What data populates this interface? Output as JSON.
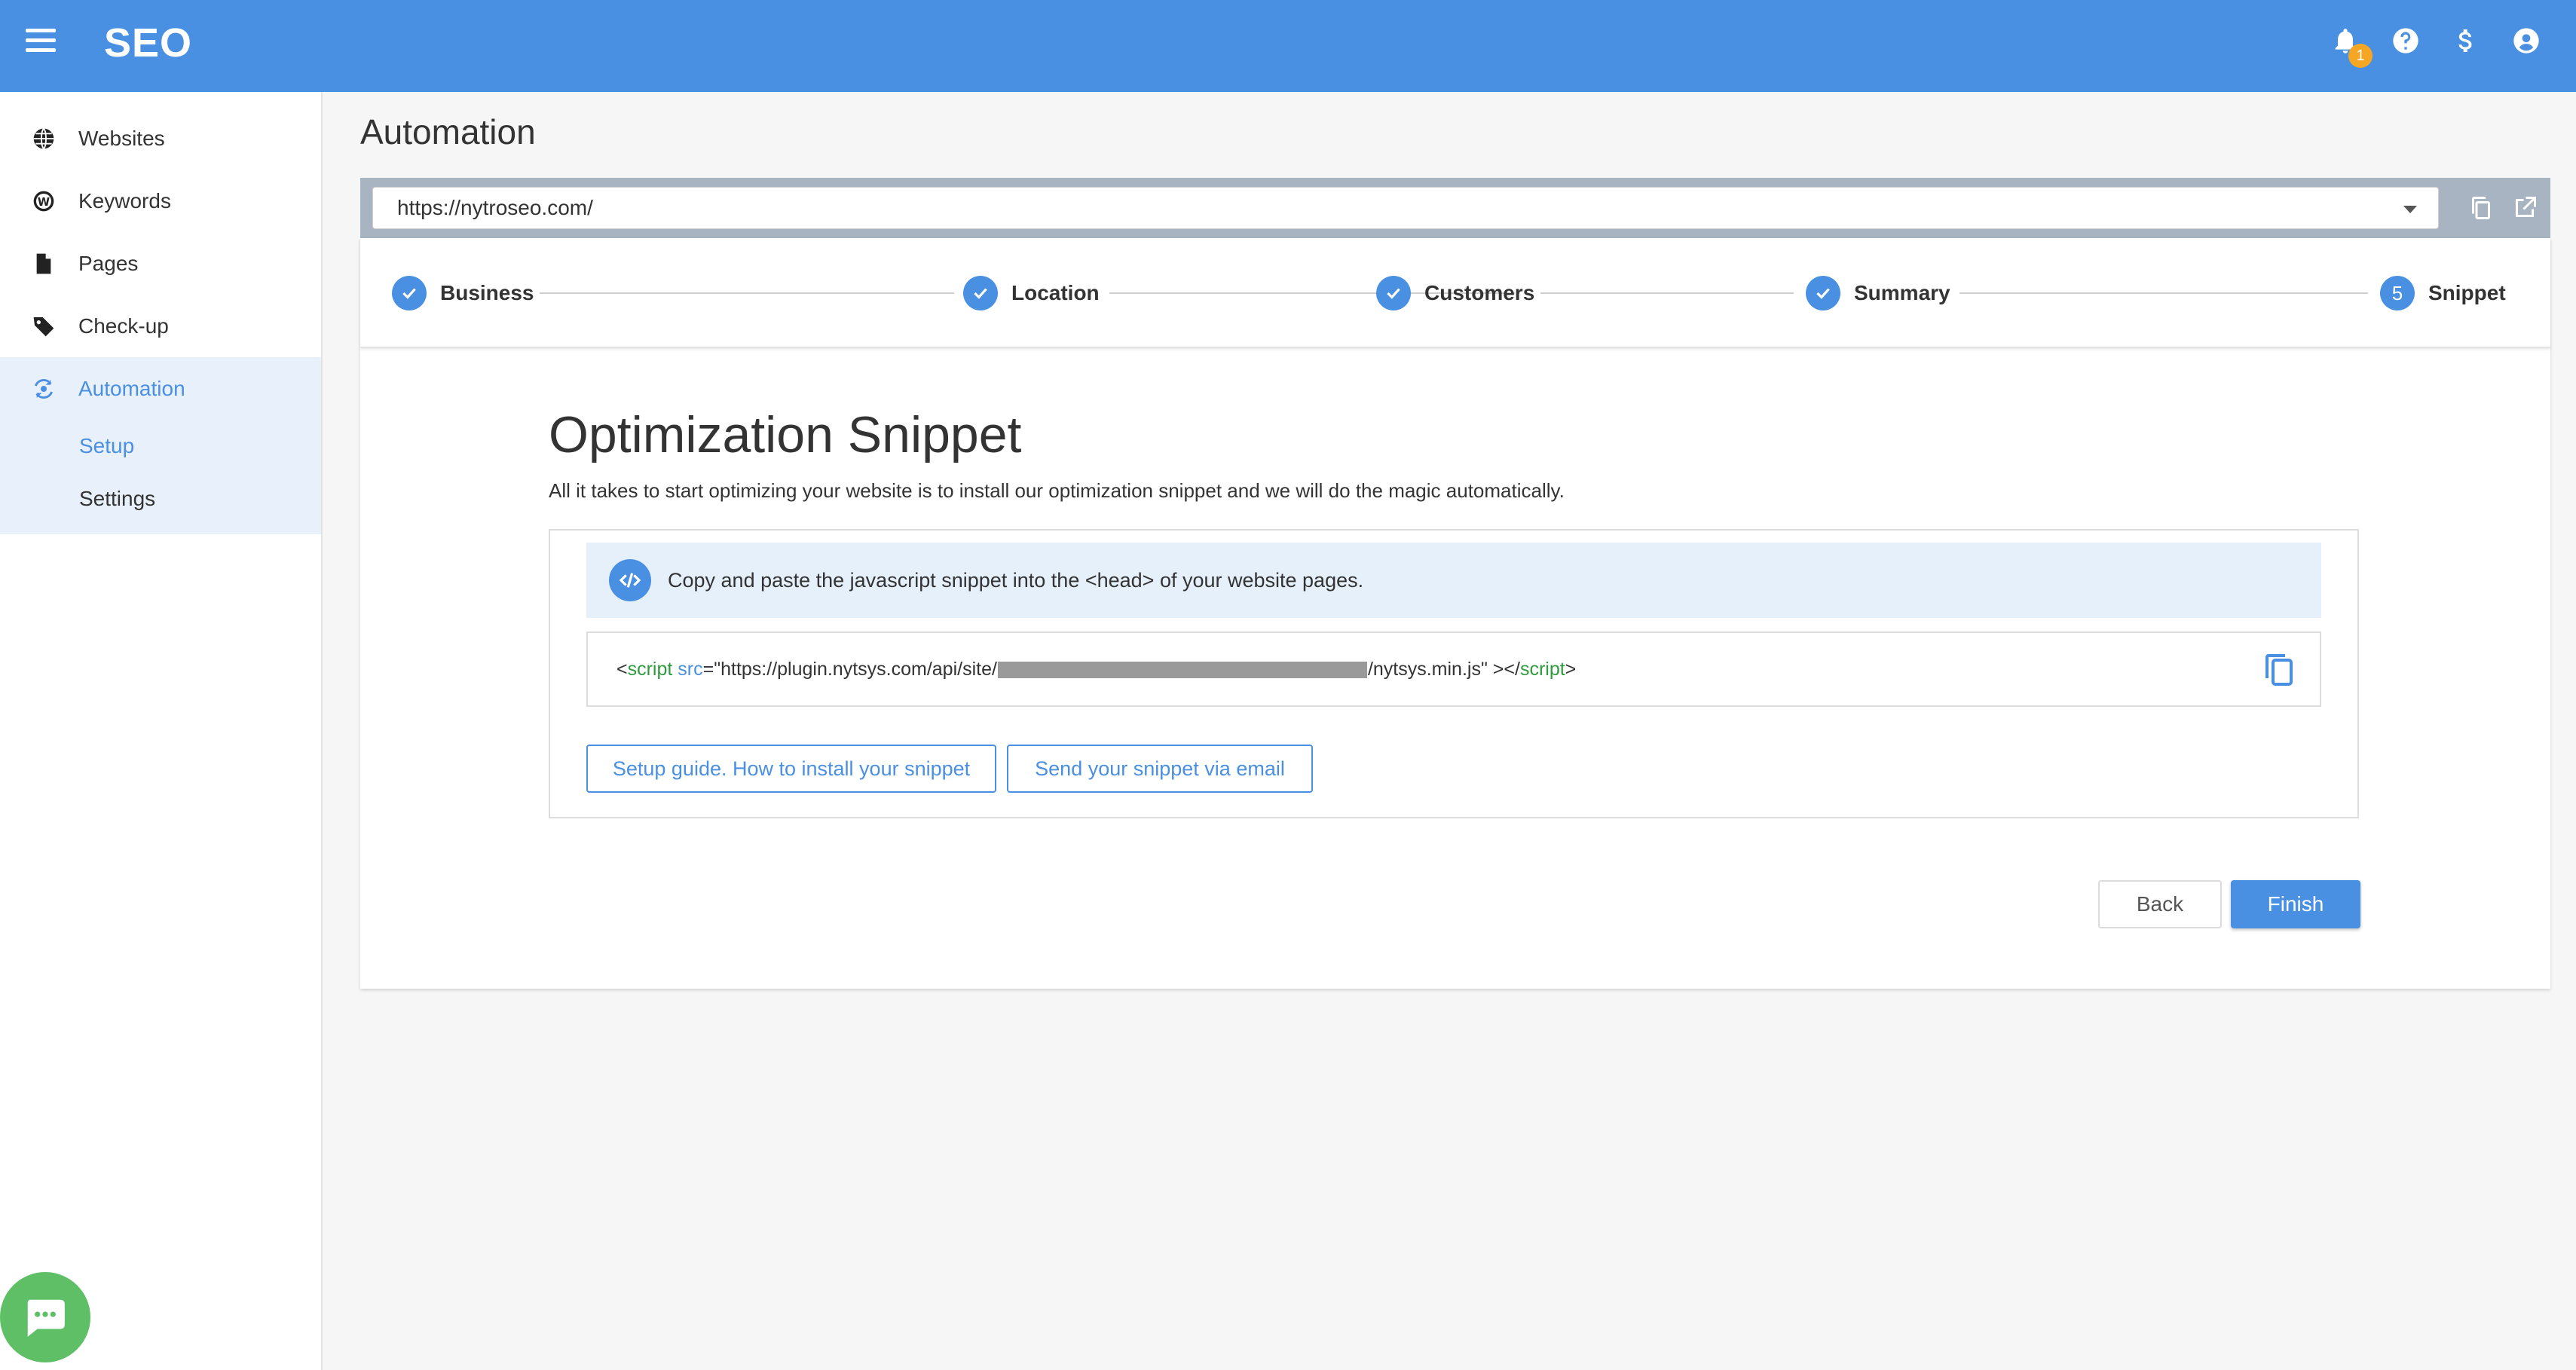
{
  "app": {
    "title": "SEO"
  },
  "header": {
    "notification_count": "1",
    "icons": [
      "bell-icon",
      "help-icon",
      "dollar-icon",
      "account-icon"
    ]
  },
  "sidebar": {
    "items": [
      {
        "label": "Websites",
        "icon": "globe-icon"
      },
      {
        "label": "Keywords",
        "icon": "wordpress-icon"
      },
      {
        "label": "Pages",
        "icon": "page-icon"
      },
      {
        "label": "Check-up",
        "icon": "tag-icon"
      },
      {
        "label": "Automation",
        "icon": "automation-icon",
        "active": true
      }
    ],
    "subitems": [
      {
        "label": "Setup",
        "active": true
      },
      {
        "label": "Settings"
      }
    ]
  },
  "page": {
    "title": "Automation"
  },
  "website_select": {
    "value": "https://nytroseo.com/"
  },
  "stepper": {
    "steps": [
      {
        "label": "Business",
        "state": "done"
      },
      {
        "label": "Location",
        "state": "done"
      },
      {
        "label": "Customers",
        "state": "done"
      },
      {
        "label": "Summary",
        "state": "done"
      },
      {
        "label": "Snippet",
        "number": "5",
        "state": "current"
      }
    ]
  },
  "snippet": {
    "title": "Optimization Snippet",
    "description": "All it takes to start optimizing your website is to install our optimization snippet and we will do the magic automatically.",
    "instruction": "Copy and paste the javascript snippet into the <head> of your website pages.",
    "code": {
      "open_bracket": "<",
      "tag": "script",
      "attr": "src",
      "url_prefix": "=\"https://plugin.nytsys.com/api/site/",
      "url_suffix": "/nytsys.min.js\" ></",
      "close_tag": "script",
      "close_bracket": ">"
    },
    "setup_guide_label": "Setup guide. How to install your snippet",
    "email_label": "Send your snippet via email"
  },
  "actions": {
    "back_label": "Back",
    "finish_label": "Finish"
  },
  "colors": {
    "primary": "#4a90e2",
    "badge": "#f5a623",
    "chat": "#5fbf67",
    "code_tag": "#2e9b3e"
  }
}
